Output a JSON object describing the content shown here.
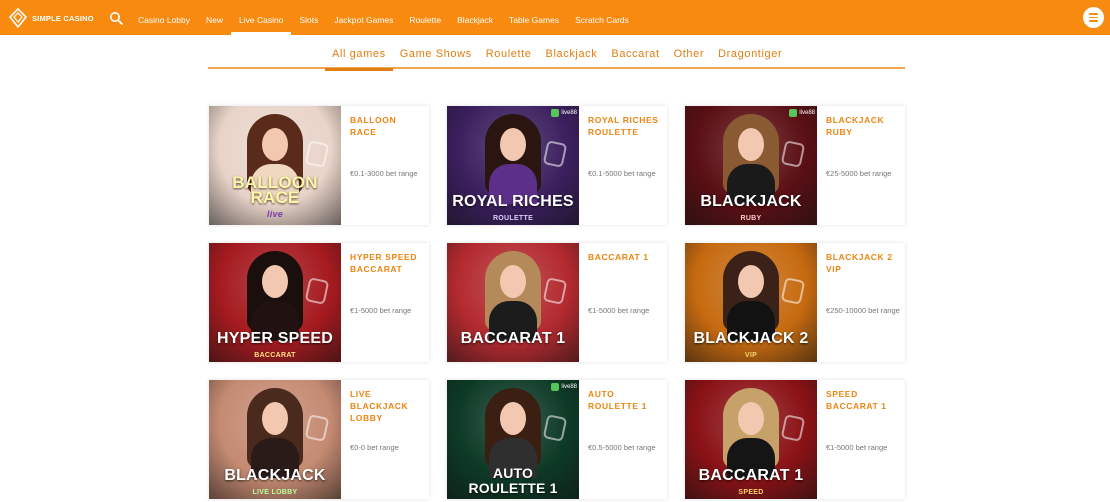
{
  "header": {
    "logo_text": "SIMPLE CASINO",
    "search_icon": "search-icon",
    "menu_icon": "hamburger-menu-icon",
    "brand_color": "#f78a0f",
    "nav": [
      {
        "label": "Casino Lobby",
        "active": false
      },
      {
        "label": "New",
        "active": false
      },
      {
        "label": "Live Casino",
        "active": true
      },
      {
        "label": "Slots",
        "active": false
      },
      {
        "label": "Jackpot Games",
        "active": false
      },
      {
        "label": "Roulette",
        "active": false
      },
      {
        "label": "Blackjack",
        "active": false
      },
      {
        "label": "Table Games",
        "active": false
      },
      {
        "label": "Scratch Cards",
        "active": false
      }
    ]
  },
  "tabs": [
    {
      "label": "All games",
      "active": true
    },
    {
      "label": "Game Shows",
      "active": false
    },
    {
      "label": "Roulette",
      "active": false
    },
    {
      "label": "Blackjack",
      "active": false
    },
    {
      "label": "Baccarat",
      "active": false
    },
    {
      "label": "Other",
      "active": false
    },
    {
      "label": "Dragontiger",
      "active": false
    }
  ],
  "games": [
    {
      "title": "BALLOON RACE",
      "range": "€0.1-3000 bet range",
      "thumb_logo": "BALLOON RACE",
      "thumb_sub": "live",
      "badge": "",
      "bg": "#e9d4c9",
      "hair": "#5a2a1a",
      "dress": "#f0d7c0",
      "sub_color": "#ffffff"
    },
    {
      "title": "ROYAL RICHES ROULETTE",
      "range": "€0.1-5000 bet range",
      "thumb_logo": "ROYAL RICHES",
      "thumb_sub": "ROULETTE",
      "badge": "live88",
      "bg": "#3b1f5e",
      "hair": "#2a1510",
      "dress": "#5c2f88",
      "sub_color": "#dcd0ff"
    },
    {
      "title": "BLACKJACK RUBY",
      "range": "€25-5000 bet range",
      "thumb_logo": "BLACKJACK",
      "thumb_sub": "RUBY",
      "badge": "live88",
      "bg": "#5a0f14",
      "hair": "#8a5a33",
      "dress": "#1a1a1a",
      "sub_color": "#ffc9c9"
    },
    {
      "title": "HYPER SPEED BACCARAT",
      "range": "€1-5000 bet range",
      "thumb_logo": "HYPER SPEED",
      "thumb_sub": "BACCARAT",
      "badge": "",
      "bg": "#a51a1f",
      "hair": "#1a0f0c",
      "dress": "#221111",
      "sub_color": "#ffe28a"
    },
    {
      "title": "BACCARAT 1",
      "range": "€1-5000 bet range",
      "thumb_logo": "BACCARAT 1",
      "thumb_sub": "",
      "badge": "",
      "bg": "#b32a2f",
      "hair": "#b58a5a",
      "dress": "#1c1c1c",
      "sub_color": "#ffffff"
    },
    {
      "title": "BLACKJACK 2 VIP",
      "range": "€250-10000 bet range",
      "thumb_logo": "BLACKJACK 2",
      "thumb_sub": "VIP",
      "badge": "",
      "bg": "#c66a10",
      "hair": "#3a2218",
      "dress": "#121212",
      "sub_color": "#ffd06b"
    },
    {
      "title": "LIVE BLACKJACK LOBBY",
      "range": "€0-0 bet range",
      "thumb_logo": "BLACKJACK",
      "thumb_sub": "LIVE LOBBY",
      "badge": "",
      "bg": "#c58a72",
      "hair": "#4a2a1c",
      "dress": "#2a1a18",
      "sub_color": "#b9ff9a"
    },
    {
      "title": "AUTO ROULETTE 1",
      "range": "€0.5-5000 bet range",
      "thumb_logo": "AUTO ROULETTE 1",
      "thumb_sub": "",
      "badge": "live88",
      "bg": "#0d3a26",
      "hair": "#3a1f12",
      "dress": "#2f2f2f",
      "sub_color": "#ffffff"
    },
    {
      "title": "SPEED BACCARAT 1",
      "range": "€1-5000 bet range",
      "thumb_logo": "BACCARAT 1",
      "thumb_sub": "SPEED",
      "badge": "",
      "bg": "#8a1216",
      "hair": "#c7a16a",
      "dress": "#151515",
      "sub_color": "#ffd06b"
    }
  ]
}
